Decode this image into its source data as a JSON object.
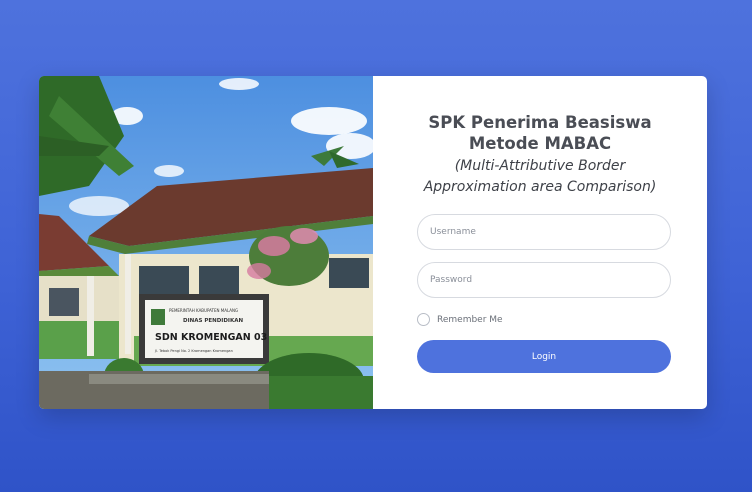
{
  "header": {
    "title_line1": "SPK Penerima Beasiswa",
    "title_line2": "Metode MABAC",
    "subtitle_line1": "(Multi-Attributive Border",
    "subtitle_line2": "Approximation area Comparison)"
  },
  "form": {
    "username_placeholder": "Username",
    "password_placeholder": "Password",
    "remember_label": "Remember Me",
    "login_label": "Login"
  },
  "photo": {
    "sign_line1": "PEMERINTAH KABUPATEN MALANG",
    "sign_line2": "DINAS PENDIDIKAN",
    "sign_line3": "SDN KROMENGAN 03",
    "sign_line4": "Jl. Tebok Pengi No. 2 Kromengan   Kromengan"
  },
  "colors": {
    "accent": "#4e72dd",
    "background_top": "#4e72dd",
    "background_bottom": "#2f53c8"
  }
}
